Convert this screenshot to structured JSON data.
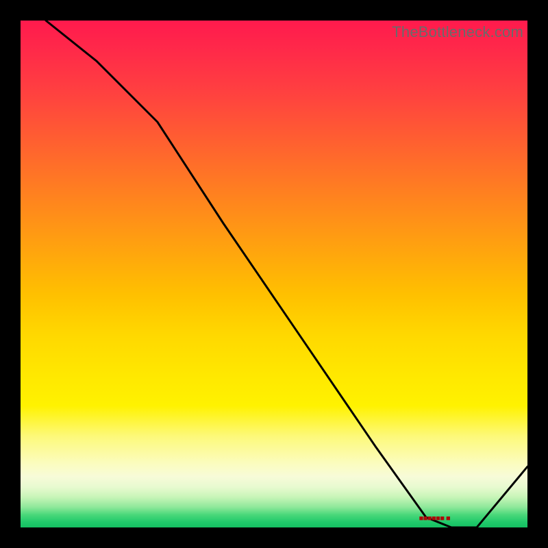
{
  "watermark": "TheBottleneck.com",
  "marker_label": "■■■■■■ ■",
  "chart_data": {
    "type": "line",
    "title": "",
    "xlabel": "",
    "ylabel": "",
    "xlim": [
      0,
      100
    ],
    "ylim": [
      0,
      100
    ],
    "series": [
      {
        "name": "bottleneck-curve",
        "x": [
          5,
          15,
          27,
          40,
          55,
          70,
          80,
          85,
          90,
          100
        ],
        "y": [
          100,
          92,
          80,
          60,
          38,
          16,
          2,
          0,
          0,
          12
        ]
      }
    ],
    "annotations": [
      {
        "name": "optimal-marker",
        "x": 84,
        "y": 1.5
      }
    ],
    "background_gradient": {
      "top_color": "#ff1a4d",
      "mid_color": "#ffe800",
      "bottom_color": "#15c062"
    }
  }
}
